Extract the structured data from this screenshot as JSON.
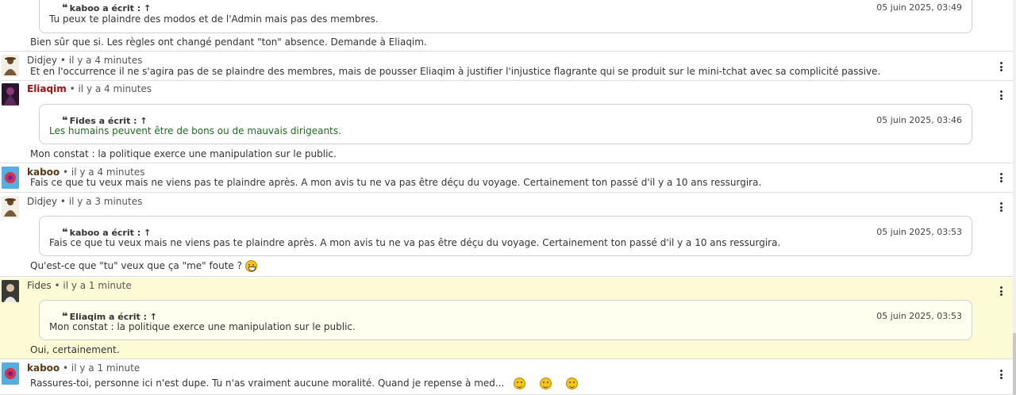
{
  "messages": [
    {
      "quote": {
        "author_line": "kaboo a écrit : ↑",
        "date": "05 juin 2025, 03:49",
        "text": "Tu peux te plaindre des modos et de l'Admin mais pas des membres."
      },
      "text": "Bien sûr que si. Les règles ont changé pendant \"ton\" absence. Demande à Eliaqim."
    },
    {
      "author": "Didjey",
      "sep": "•",
      "time": "il y a 4 minutes",
      "text": "Et en l'occurrence il ne s'agira pas de se plaindre des membres, mais de pousser Eliaqim à justifier l'injustice flagrante qui se produit sur le mini-tchat avec sa complicité passive."
    },
    {
      "author": "Eliaqim",
      "sep": "•",
      "time": "il y a 4 minutes",
      "quote": {
        "author_line": "Fides a écrit : ↑",
        "date": "05 juin 2025, 03:46",
        "text": "Les humains peuvent être de bons ou de mauvais dirigeants."
      },
      "text": "Mon constat : la politique exerce une manipulation sur le public."
    },
    {
      "author": "kaboo",
      "sep": "•",
      "time": "il y a 4 minutes",
      "text": "Fais ce que tu veux mais ne viens pas te plaindre après. A mon avis tu ne va pas être déçu du voyage. Certainement ton passé d'il y a 10 ans ressurgira."
    },
    {
      "author": "Didjey",
      "sep": "•",
      "time": "il y a 3 minutes",
      "quote": {
        "author_line": "kaboo a écrit : ↑",
        "date": "05 juin 2025, 03:53",
        "text": "Fais ce que tu veux mais ne viens pas te plaindre après. A mon avis tu ne va pas être déçu du voyage. Certainement ton passé d'il y a 10 ans ressurgira."
      },
      "text": "Qu'est-ce que \"tu\" veux que ça \"me\" foute ?",
      "emoji": "laughing-emoji"
    },
    {
      "author": "Fides",
      "sep": "•",
      "time": "il y a 1 minute",
      "quote": {
        "author_line": "Eliaqim a écrit : ↑",
        "date": "05 juin 2025, 03:53",
        "text": "Mon constat : la politique exerce une manipulation sur le public."
      },
      "text": "Oui, certainement."
    },
    {
      "author": "kaboo",
      "sep": "•",
      "time": "il y a 1 minute",
      "text": "Rassures-toi, personne ici n'est dupe. Tu n'as vraiment aucune moralité. Quand je repense à med...",
      "emojis": [
        "smile-emoji",
        "smile-emoji",
        "smile-emoji"
      ]
    }
  ],
  "colors": {
    "highlight": "#fdfbd6",
    "author_red": "#a01010",
    "author_brown": "#5a3a14",
    "quote_green": "#1e6b1e"
  }
}
